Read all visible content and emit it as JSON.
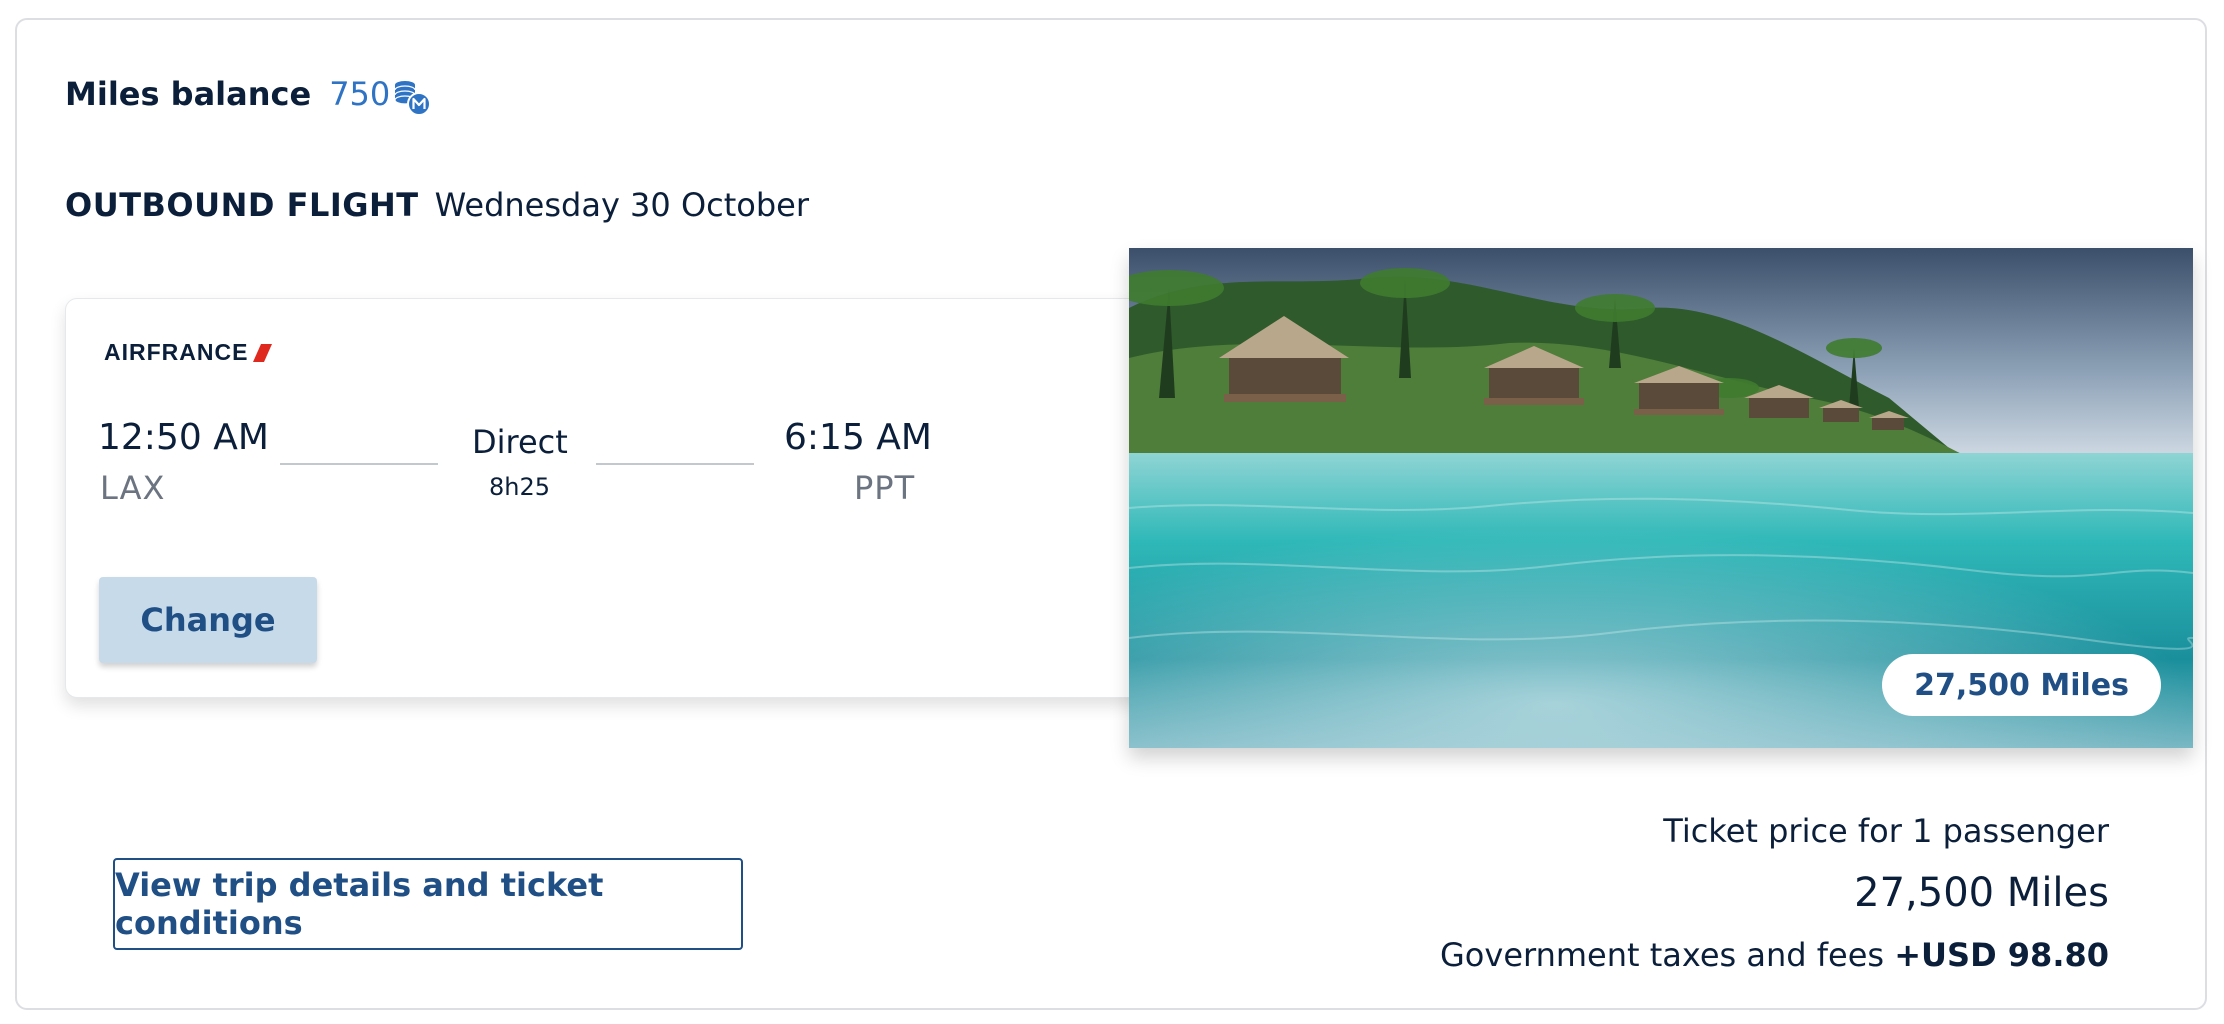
{
  "balance": {
    "label": "Miles balance",
    "value": "750"
  },
  "outbound": {
    "label": "OUTBOUND FLIGHT",
    "date": "Wednesday 30 October"
  },
  "flight": {
    "airline": "AIRFRANCE",
    "departure_time": "12:50 AM",
    "departure_code": "LAX",
    "stops": "Direct",
    "duration": "8h25",
    "arrival_time": "6:15 AM",
    "arrival_code": "PPT",
    "change_label": "Change"
  },
  "destination_image": {
    "miles_badge": "27,500 Miles"
  },
  "actions": {
    "trip_details_label": "View trip details and ticket conditions"
  },
  "price": {
    "caption": "Ticket price for 1 passenger",
    "miles": "27,500 Miles",
    "taxes_label": "Government taxes and fees",
    "taxes_value": "+USD 98.80"
  },
  "colors": {
    "brand_navy": "#0b1f3a",
    "accent_blue": "#1f4f85",
    "balance_blue": "#2f73c4",
    "change_button_bg": "#c7daea",
    "air_france_red": "#e0291e"
  },
  "icons": {
    "miles": "coin-stack-m-icon",
    "airline_logo": "air-france-stripe-icon"
  }
}
